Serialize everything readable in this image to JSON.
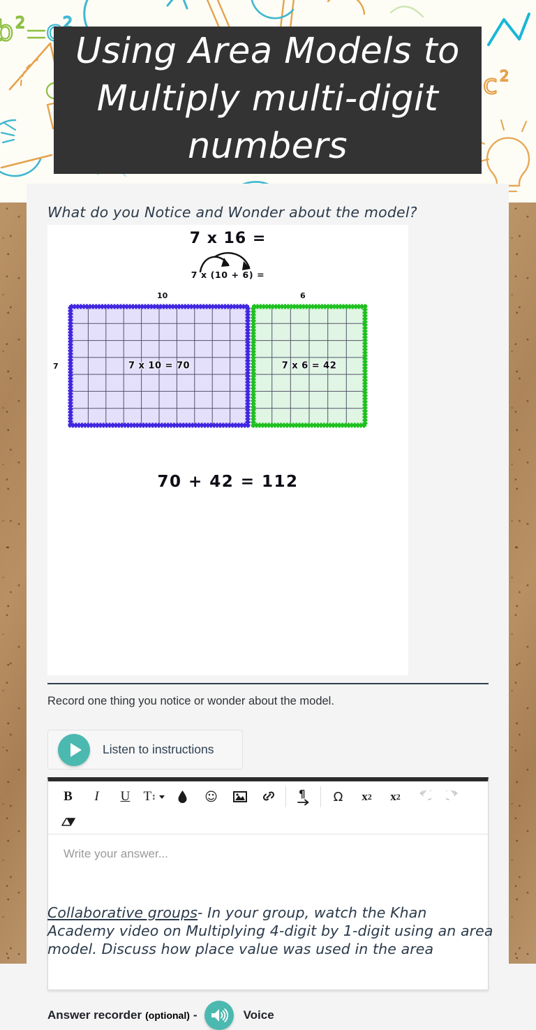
{
  "header": {
    "title": "Using Area Models to Multiply multi-digit numbers",
    "banner_bg": "#333333",
    "banner_text_color": "#ffffff"
  },
  "lesson": {
    "notice_heading": "What do you Notice and Wonder about the model?",
    "record_prompt": "Record one thing you notice or wonder about the model."
  },
  "model": {
    "equation_top": "7 x 16 =",
    "equation_decomposed": "7 x (10 + 6) =",
    "equation_bottom": "70 + 42 = 112",
    "left_box": {
      "top_label": "10",
      "side_label": "7",
      "caption": "7 x 10 = 70",
      "border_color": "#4126e0",
      "fill_color": "#e4e0fb",
      "cols": 10,
      "rows": 7
    },
    "right_box": {
      "top_label": "6",
      "side_label": "7",
      "caption": "7 x 6 = 42",
      "border_color": "#20c020",
      "fill_color": "#e0f5e4",
      "cols": 6,
      "rows": 7
    }
  },
  "listen_button": {
    "label": "Listen to instructions",
    "icon": "play-icon",
    "accent_color": "#4bb9b0"
  },
  "editor": {
    "placeholder": "Write your answer...",
    "value": "",
    "toolbar_row1": [
      {
        "name": "bold-icon",
        "glyph": "B",
        "style": "bold",
        "disabled": false
      },
      {
        "name": "italic-icon",
        "glyph": "I",
        "style": "italic",
        "disabled": false
      },
      {
        "name": "underline-icon",
        "glyph": "U",
        "style": "underline",
        "disabled": false
      },
      {
        "name": "text-size-icon",
        "glyph": "T",
        "style": "dropdown",
        "disabled": false
      },
      {
        "name": "text-color-icon",
        "glyph": "drop",
        "style": "shape",
        "disabled": false
      },
      {
        "name": "emoji-icon",
        "glyph": "☺",
        "style": "plain",
        "disabled": false
      },
      {
        "name": "insert-image-icon",
        "glyph": "image",
        "style": "shape",
        "disabled": false
      },
      {
        "name": "insert-link-icon",
        "glyph": "link",
        "style": "shape",
        "disabled": false
      },
      {
        "name": "separator",
        "glyph": "",
        "style": "sep",
        "disabled": false
      },
      {
        "name": "paragraph-indent-icon",
        "glyph": "¶",
        "style": "pilcrow",
        "disabled": false
      },
      {
        "name": "separator",
        "glyph": "",
        "style": "sep",
        "disabled": false
      },
      {
        "name": "special-character-icon",
        "glyph": "Ω",
        "style": "plain",
        "disabled": false
      },
      {
        "name": "subscript-icon",
        "glyph": "x₂",
        "style": "sub",
        "disabled": false
      },
      {
        "name": "superscript-icon",
        "glyph": "x²",
        "style": "sup",
        "disabled": false
      },
      {
        "name": "undo-icon",
        "glyph": "↺",
        "style": "plain",
        "disabled": true
      },
      {
        "name": "redo-icon",
        "glyph": "↻",
        "style": "plain",
        "disabled": true
      }
    ],
    "toolbar_row2": [
      {
        "name": "clear-formatting-icon",
        "glyph": "eraser",
        "style": "shape",
        "disabled": false
      }
    ]
  },
  "recorder": {
    "label": "Answer recorder",
    "optional": "(optional)",
    "dash": "-",
    "voice_label": "Voice",
    "icon": "speaker-icon",
    "accent_color": "#4bb9b0"
  },
  "collaborative": {
    "link_text": "Collaborative groups",
    "body": "- In your group, watch the Khan Academy video on Multiplying 4-digit by 1-digit using an area model.  Discuss how place value was used in the area"
  }
}
